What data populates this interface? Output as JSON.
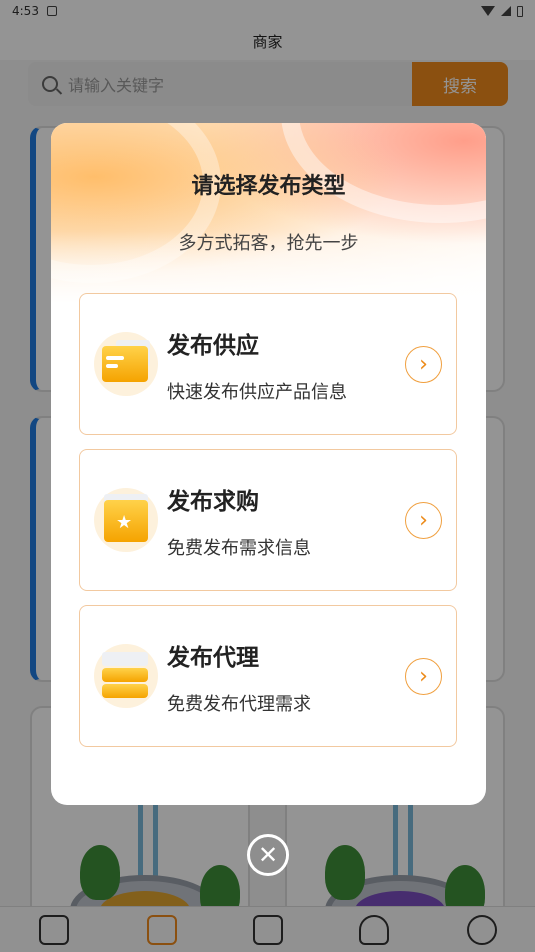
{
  "status_bar": {
    "time": "4:53"
  },
  "header": {
    "title": "商家"
  },
  "search": {
    "placeholder": "请输入关键字",
    "button_label": "搜索"
  },
  "modal": {
    "title": "请选择发布类型",
    "subtitle": "多方式拓客，抢先一步",
    "options": [
      {
        "title": "发布供应",
        "desc": "快速发布供应产品信息",
        "icon": "supply-box-icon"
      },
      {
        "title": "发布求购",
        "desc": "免费发布需求信息",
        "icon": "purchase-star-icon"
      },
      {
        "title": "发布代理",
        "desc": "免费发布代理需求",
        "icon": "agent-stack-icon"
      }
    ],
    "arrow_glyph": "›",
    "close_glyph": "✕"
  },
  "colors": {
    "accent": "#f08a1c",
    "option_border": "#f2c9a0",
    "background_blue": "#1f7be0"
  }
}
